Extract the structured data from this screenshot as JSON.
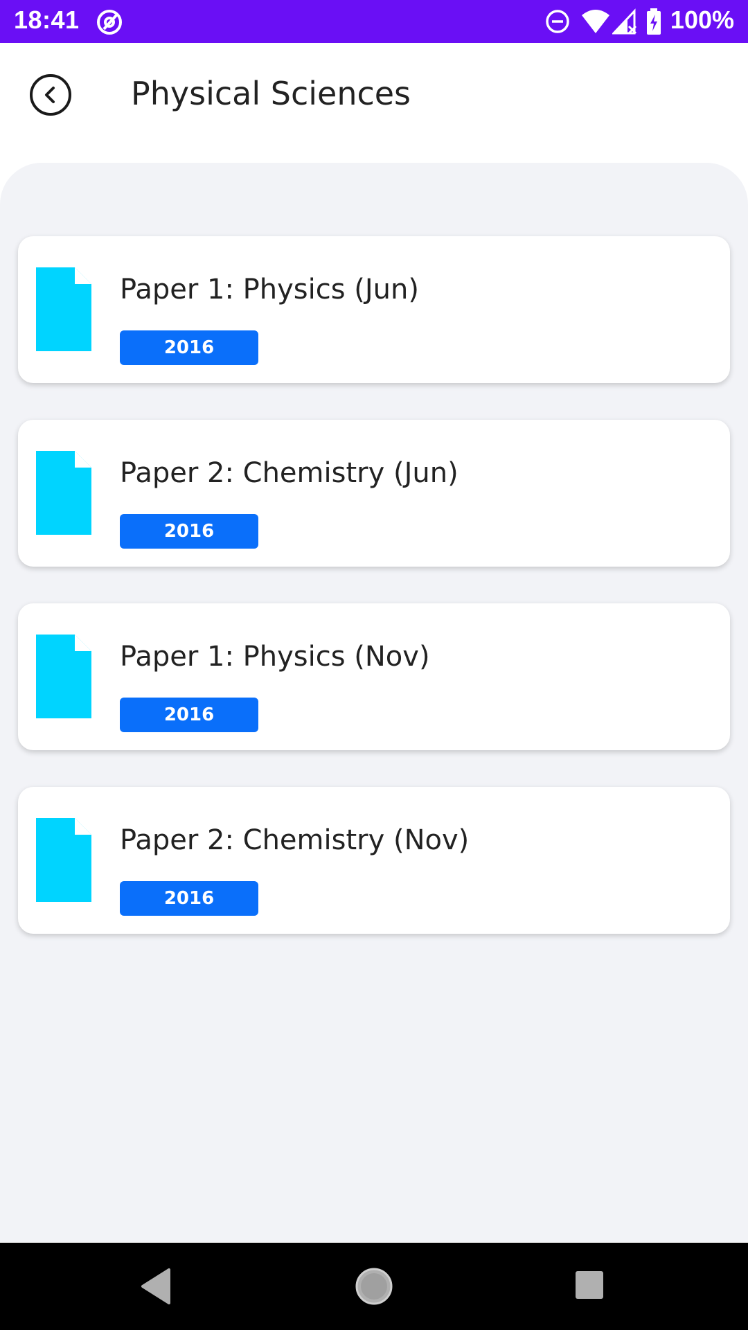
{
  "status_bar": {
    "time": "18:41",
    "battery": "100%",
    "icons": [
      "at-sign-icon",
      "do-not-disturb-icon",
      "wifi-icon",
      "signal-icon",
      "battery-icon"
    ]
  },
  "header": {
    "title": "Physical Sciences",
    "back_icon": "chevron-left-icon"
  },
  "papers": [
    {
      "title": "Paper 1: Physics (Jun)",
      "year": "2016",
      "icon": "document-icon"
    },
    {
      "title": "Paper 2: Chemistry (Jun)",
      "year": "2016",
      "icon": "document-icon"
    },
    {
      "title": "Paper 1: Physics (Nov)",
      "year": "2016",
      "icon": "document-icon"
    },
    {
      "title": "Paper 2: Chemistry (Nov)",
      "year": "2016",
      "icon": "document-icon"
    }
  ],
  "nav_bar": {
    "buttons": [
      "back-triangle-icon",
      "home-circle-icon",
      "recents-square-icon"
    ]
  },
  "colors": {
    "status_bar": "#6a0ff5",
    "document_icon": "#00d4ff",
    "badge": "#0a6ffa",
    "background": "#f2f3f7"
  }
}
